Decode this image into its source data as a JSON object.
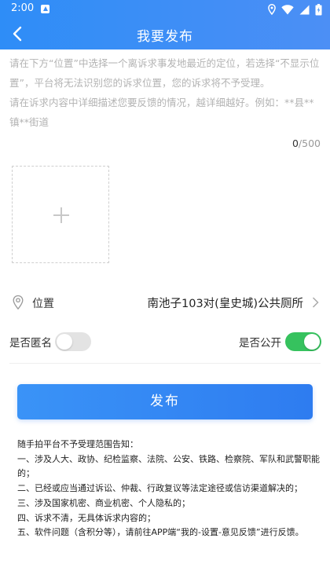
{
  "status_bar": {
    "time": "2:00",
    "icons": [
      "app-notification-icon",
      "location-icon",
      "wifi-icon",
      "signal-icon",
      "battery-icon"
    ]
  },
  "header": {
    "title": "我要发布",
    "back_icon": "chevron-left-icon",
    "gradient_colors": [
      "#2e8df7",
      "#4c8ff5"
    ]
  },
  "description": {
    "placeholder_line1": "请在下方“位置”中选择一个离诉求事发地最近的定位，若选择“不显示位置”，平台将无法识别您的诉求位置，您的诉求将不予受理。",
    "placeholder_line2": "请在诉求内容中详细描述您要反馈的情况，越详细越好。例如：**县**镇**街道",
    "count": "0",
    "max": "/500"
  },
  "upload": {
    "icon": "plus-icon"
  },
  "location": {
    "label": "位置",
    "value": "南池子103对(皇史城)公共厕所",
    "icon": "location-pin-icon"
  },
  "toggles": {
    "anonymous_label": "是否匿名",
    "anonymous_on": false,
    "public_label": "是否公开",
    "public_on": true,
    "on_color": "#36c25e"
  },
  "publish_button": {
    "label": "发布",
    "color": "#3a93f7"
  },
  "notice": {
    "title": "随手拍平台不予受理范围告知：",
    "items": [
      "一、涉及人大、政协、纪检监察、法院、公安、铁路、检察院、军队和武警职能的；",
      "二、已经或应当通过诉讼、仲裁、行政复议等法定途径或信访渠道解决的；",
      "三、涉及国家机密、商业机密、个人隐私的；",
      "四、诉求不清，无具体诉求内容的；",
      "五、软件问题（含积分等），请前往APP端“我的-设置-意见反馈”进行反馈。"
    ]
  }
}
